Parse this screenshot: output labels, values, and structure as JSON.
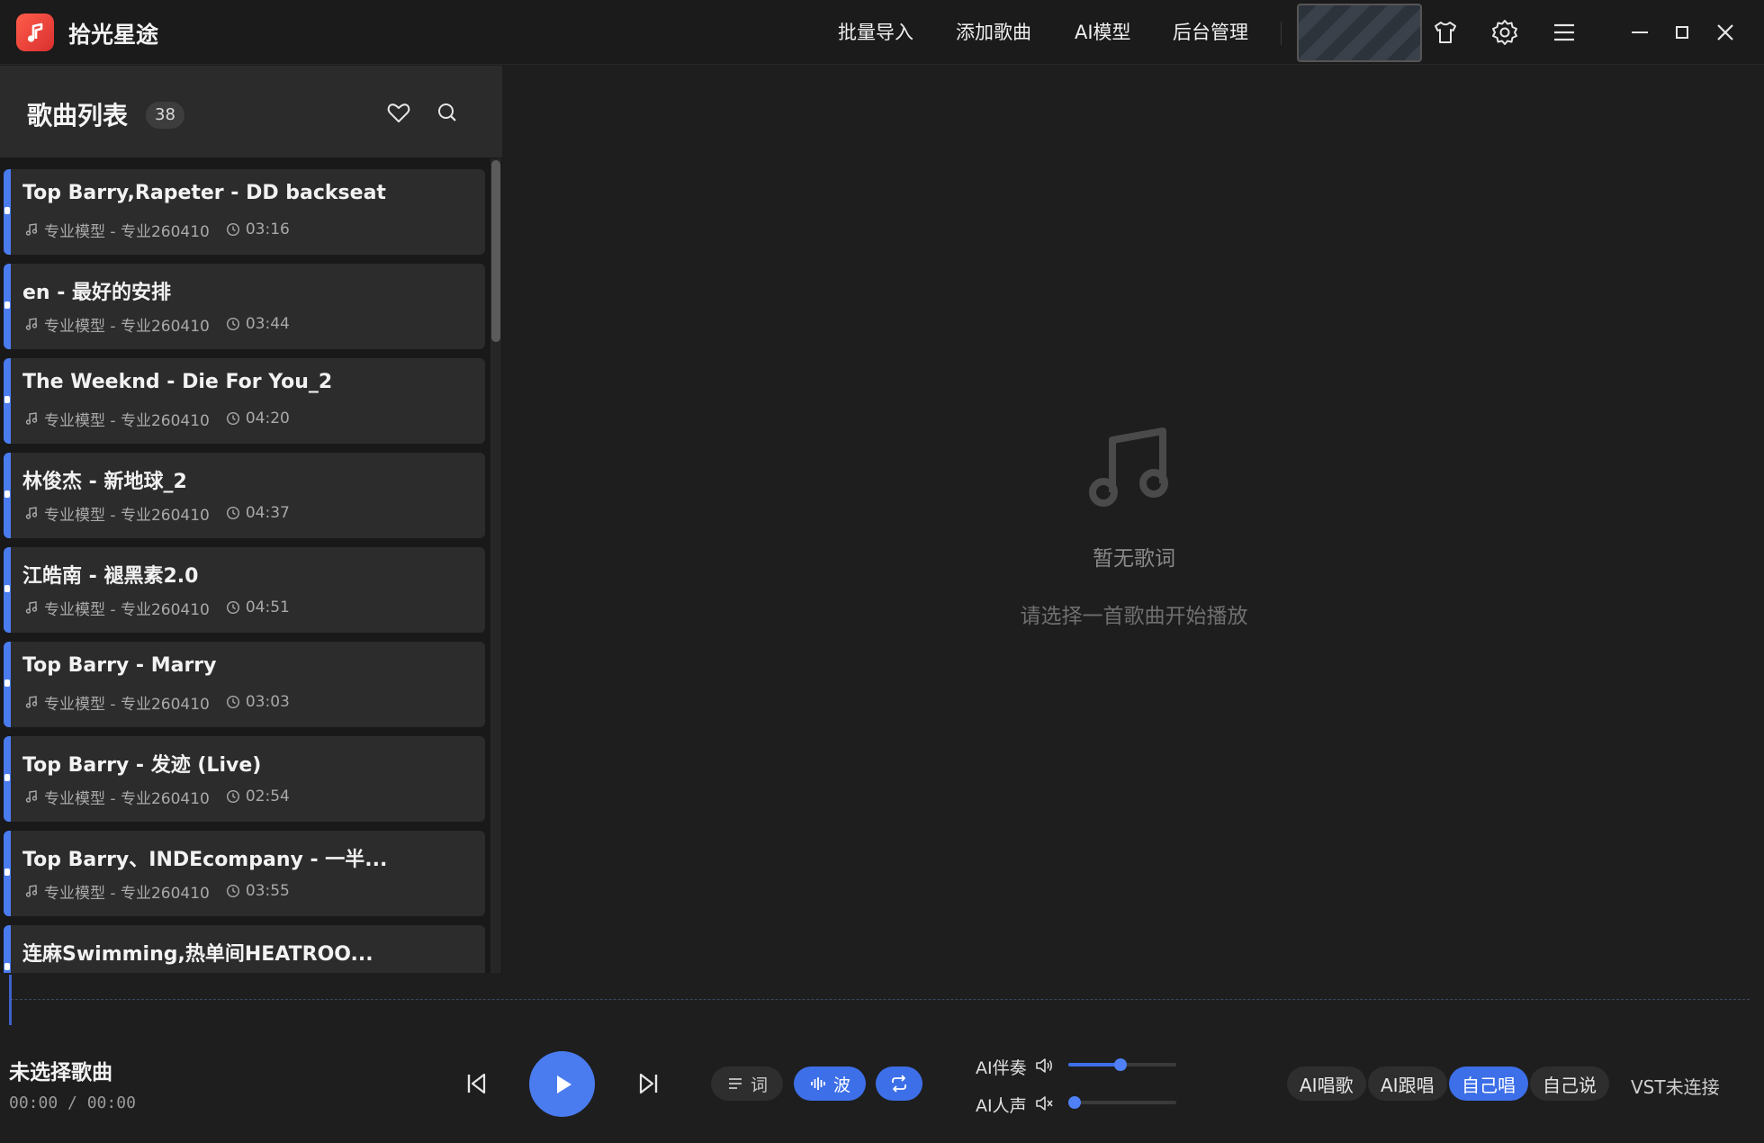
{
  "app": {
    "name": "拾光星途"
  },
  "nav": {
    "batch_import": "批量导入",
    "add_song": "添加歌曲",
    "ai_model": "AI模型",
    "admin": "后台管理"
  },
  "sidebar": {
    "title": "歌曲列表",
    "count": "38",
    "songs": [
      {
        "title": "Top Barry,Rapeter - DD backseat",
        "meta": "专业模型 - 专业260410",
        "duration": "03:16"
      },
      {
        "title": "en - 最好的安排",
        "meta": "专业模型 - 专业260410",
        "duration": "03:44"
      },
      {
        "title": "The Weeknd - Die For You_2",
        "meta": "专业模型 - 专业260410",
        "duration": "04:20"
      },
      {
        "title": "林俊杰 - 新地球_2",
        "meta": "专业模型 - 专业260410",
        "duration": "04:37"
      },
      {
        "title": "江皓南 - 褪黑素2.0",
        "meta": "专业模型 - 专业260410",
        "duration": "04:51"
      },
      {
        "title": "Top Barry - Marry",
        "meta": "专业模型 - 专业260410",
        "duration": "03:03"
      },
      {
        "title": "Top Barry - 发迹 (Live)",
        "meta": "专业模型 - 专业260410",
        "duration": "02:54"
      },
      {
        "title": "Top Barry、INDEcompany - 一半...",
        "meta": "专业模型 - 专业260410",
        "duration": "03:55"
      },
      {
        "title": "连麻Swimming,热单间HEATROO...",
        "meta": "",
        "duration": ""
      }
    ]
  },
  "lyrics": {
    "empty_title": "暂无歌词",
    "empty_subtitle": "请选择一首歌曲开始播放"
  },
  "player": {
    "now_title": "未选择歌曲",
    "current_time": "00:00",
    "time_separator": "/",
    "total_time": "00:00",
    "lyrics_btn": "词",
    "wave_btn": "波",
    "accompaniment_label": "AI伴奏",
    "accompaniment_level": 0.48,
    "vocal_label": "AI人声",
    "vocal_level": 0.0
  },
  "modes": {
    "ai_sing": "AI唱歌",
    "ai_follow": "AI跟唱",
    "self_sing": "自己唱",
    "self_talk": "自己说",
    "vst_status": "VST未连接"
  },
  "colors": {
    "accent": "#4a7cf0",
    "background": "#1e1e1e",
    "sidebar_header": "#2b2b2b",
    "song_card": "#2c2c2c"
  }
}
